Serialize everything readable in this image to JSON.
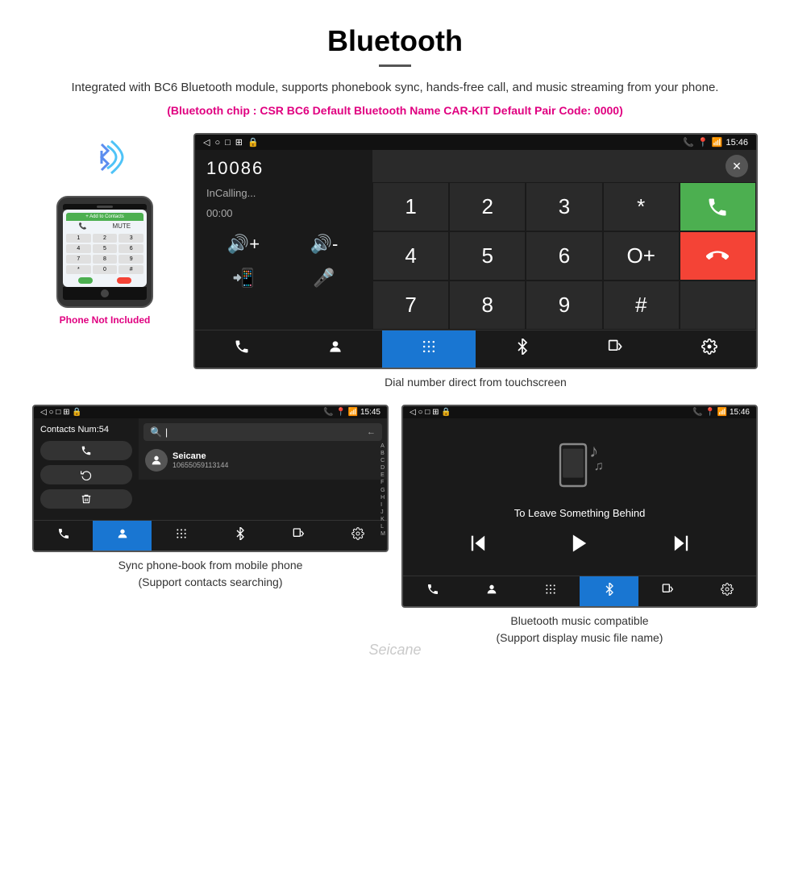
{
  "header": {
    "title": "Bluetooth",
    "description": "Integrated with BC6 Bluetooth module, supports phonebook sync, hands-free call, and music streaming from your phone.",
    "specs": "(Bluetooth chip : CSR BC6    Default Bluetooth Name CAR-KIT    Default Pair Code: 0000)"
  },
  "phone": {
    "not_included_label": "Phone Not Included"
  },
  "dial_screen": {
    "status_bar": {
      "time": "15:46"
    },
    "number": "10086",
    "calling_status": "InCalling...",
    "timer": "00:00",
    "caption": "Dial number direct from touchscreen"
  },
  "contacts_screen": {
    "contacts_num": "Contacts Num:54",
    "contact_name": "Seicane",
    "contact_phone": "10655059113144",
    "status_bar_time": "15:45",
    "caption_line1": "Sync phone-book from mobile phone",
    "caption_line2": "(Support contacts searching)"
  },
  "music_screen": {
    "status_bar_time": "15:46",
    "song_title": "To Leave Something Behind",
    "caption_line1": "Bluetooth music compatible",
    "caption_line2": "(Support display music file name)"
  },
  "watermark": "Seicane"
}
